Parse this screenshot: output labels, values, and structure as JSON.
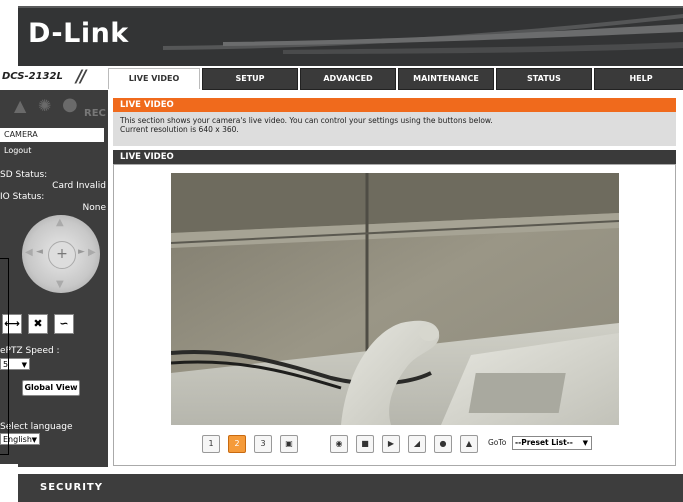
{
  "brand": {
    "logo": "D-Link",
    "model": "DCS-2132L"
  },
  "nav": {
    "tabs": [
      {
        "label": "LIVE VIDEO",
        "active": true
      },
      {
        "label": "SETUP",
        "active": false
      },
      {
        "label": "ADVANCED",
        "active": false
      },
      {
        "label": "MAINTENANCE",
        "active": false
      },
      {
        "label": "STATUS",
        "active": false
      },
      {
        "label": "HELP",
        "active": false
      }
    ]
  },
  "sidebar": {
    "rec_label": "REC",
    "camera": "CAMERA",
    "logout": "Logout",
    "sd_status_label": "SD Status:",
    "sd_status_value": "Card Invalid",
    "io_status_label": "IO Status:",
    "io_status_value": "None",
    "eptz_speed_label": "ePTZ Speed :",
    "eptz_speed_value": "5",
    "global_view": "Global View",
    "language_label": "Select language",
    "language_value": "English"
  },
  "main": {
    "section_title": "LIVE VIDEO",
    "description_line1": "This section shows your camera's live video. You can control your settings using the buttons below.",
    "description_line2": "Current resolution is 640 x 360.",
    "video_title": "LIVE VIDEO",
    "goto_label": "GoTo",
    "preset_value": "--Preset List--",
    "stream_buttons": [
      "1",
      "2",
      "3"
    ],
    "active_stream": "2"
  },
  "footer": {
    "label": "SECURITY"
  },
  "colors": {
    "accent": "#f06a1c",
    "dark": "#3d3d3d"
  }
}
